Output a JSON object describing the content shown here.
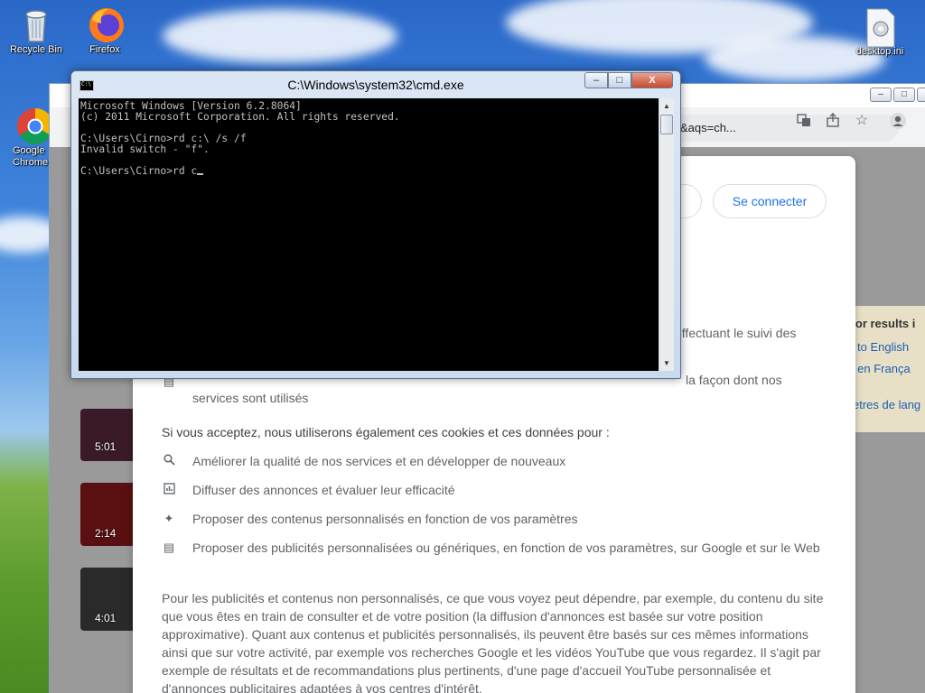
{
  "desktop": {
    "icons": [
      {
        "label": "Recycle Bin",
        "icon": "recycle-bin-icon"
      },
      {
        "label": "Firefox",
        "icon": "firefox-icon"
      },
      {
        "label": "Google Chrome",
        "icon": "chrome-icon"
      },
      {
        "label": "desktop.ini",
        "icon": "settings-file-icon"
      }
    ]
  },
  "cmd": {
    "title": "C:\\Windows\\system32\\cmd.exe",
    "lines": [
      "Microsoft Windows [Version 6.2.8064]",
      "(c) 2011 Microsoft Corporation. All rights reserved.",
      "",
      "C:\\Users\\Cirno>rd c:\\ /s /f",
      "Invalid switch - \"f\".",
      "",
      "C:\\Users\\Cirno>rd c"
    ],
    "buttons": {
      "minimize": "‒",
      "maximize": "□",
      "close": "X"
    }
  },
  "chrome": {
    "window_buttons": {
      "minimize": "‒",
      "maximize": "□"
    },
    "omnibox_text": "+ZERTY&aqs=ch...",
    "videos": [
      {
        "duration": "5:01"
      },
      {
        "duration": "2:14"
      },
      {
        "duration": "4:01"
      }
    ],
    "side_card": {
      "lines": [
        "g for results i",
        "to English",
        "er en França",
        "etres de lang"
      ]
    },
    "consent": {
      "signin_label": "Se connecter",
      "partial_line_1": "effectuant le suivi des",
      "partial_line_2": "la façon dont nos",
      "services_line": "services sont utilisés",
      "intro": "Si vous acceptez, nous utiliserons également ces cookies et ces données pour :",
      "items": [
        {
          "icon": "search-icon",
          "text": "Améliorer la qualité de nos services et en développer de nouveaux"
        },
        {
          "icon": "chart-icon",
          "text": "Diffuser des annonces et évaluer leur efficacité"
        },
        {
          "icon": "sparkle-icon",
          "text": "Proposer des contenus personnalisés en fonction de vos paramètres"
        },
        {
          "icon": "ad-icon",
          "text": "Proposer des publicités personnalisées ou génériques, en fonction de vos paramètres, sur Google et sur le Web"
        }
      ],
      "paragraph": "Pour les publicités et contenus non personnalisés, ce que vous voyez peut dépendre, par exemple, du contenu du site que vous êtes en train de consulter et de votre position (la diffusion d'annonces est basée sur votre position approximative). Quant aux contenus et publicités personnalisés, ils peuvent être basés sur ces mêmes informations ainsi que sur votre activité, par exemple vos recherches Google et les vidéos YouTube que vous regardez. Il s'agit par exemple de résultats et de recommandations plus pertinents, d'une page d'accueil YouTube personnalisée et d'annonces publicitaires adaptées à vos centres d'intérêt."
    }
  }
}
